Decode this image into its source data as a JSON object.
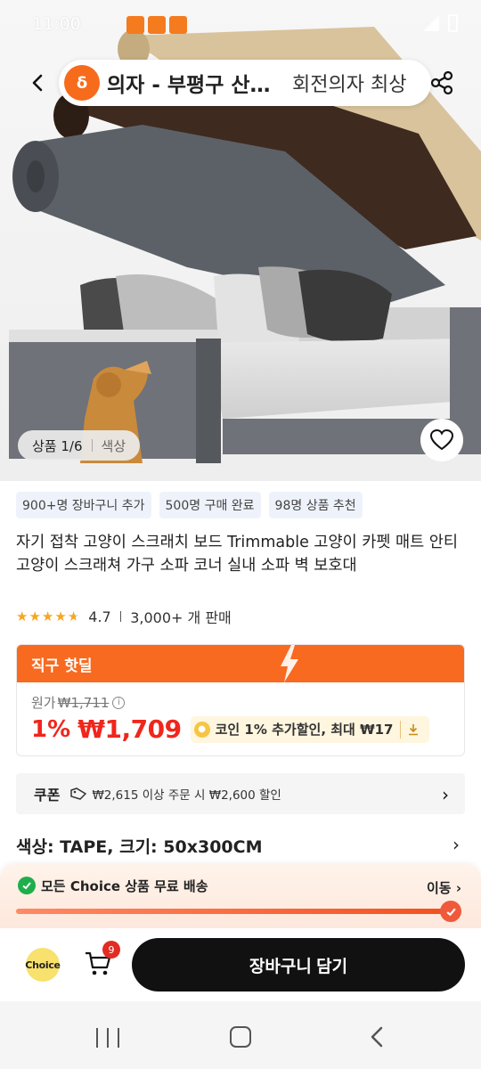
{
  "status_bar": {
    "time": "11:00"
  },
  "header": {
    "search_query": "의자 - 부평구 산곡동",
    "search_suggestion": "회전의자 최상"
  },
  "gallery": {
    "counter_label": "상품 1/6",
    "counter_tab": "색상"
  },
  "tags": [
    "900+명 장바구니 추가",
    "500명 구매 완료",
    "98명 상품 추천"
  ],
  "product": {
    "title": "자기 접착 고양이 스크래치 보드 Trimmable 고양이 카펫 매트 안티 고양이 스크래쳐 가구 소파 코너 실내 소파 벽 보호대",
    "rating": "4.7",
    "sold": "3,000+ 개 판매",
    "stars": 4.7
  },
  "deal": {
    "banner": "직구 핫딜",
    "original_label": "원가",
    "original_price": "₩1,711",
    "discount": "1%",
    "price": "₩1,709",
    "coin_text": "코인 1% 추가할인, 최대 ₩17"
  },
  "coupon": {
    "label": "쿠폰",
    "text": "₩2,615 이상 주문 시 ₩2,600 할인"
  },
  "variant": {
    "text": "색상: TAPE, 크기: 50x300CM"
  },
  "shipping": {
    "text": "모든 Choice 상품 무료 배송",
    "link": "이동",
    "progress": 1.0
  },
  "actionbar": {
    "choice_label": "Choice",
    "cart_count": "9",
    "add_to_cart": "장바구니 담기"
  },
  "colors": {
    "accent": "#f76a20",
    "price_red": "#f0261c",
    "button_dark": "#111111"
  }
}
